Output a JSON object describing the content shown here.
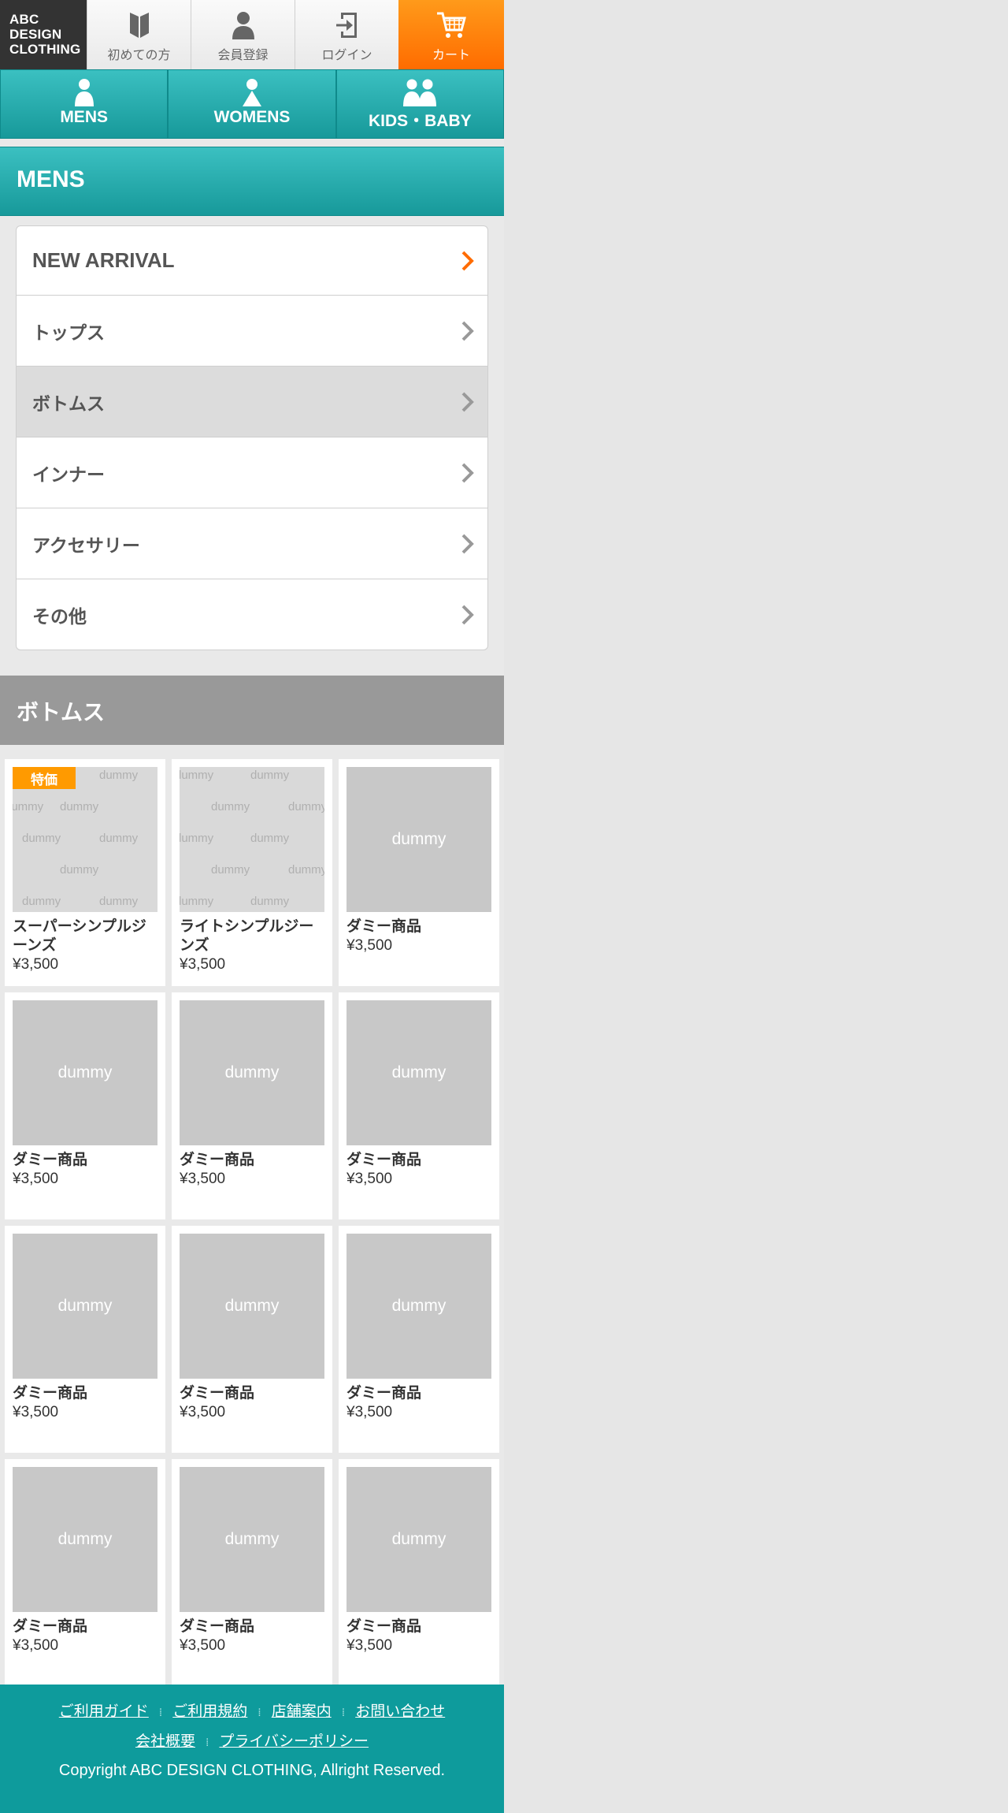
{
  "brand": {
    "logo_lines": [
      "ABC",
      "DESIGN",
      "CLOTHING"
    ]
  },
  "header": {
    "buttons": [
      {
        "label": "初めての方",
        "icon": "book-icon"
      },
      {
        "label": "会員登録",
        "icon": "person-icon"
      },
      {
        "label": "ログイン",
        "icon": "login-icon"
      },
      {
        "label": "カート",
        "icon": "cart-icon"
      }
    ]
  },
  "tabs": [
    {
      "label": "MENS",
      "icon": "man-icon"
    },
    {
      "label": "WOMENS",
      "icon": "woman-icon"
    },
    {
      "label": "KIDS・BABY",
      "icon": "family-icon"
    }
  ],
  "section": {
    "title": "MENS"
  },
  "menu": [
    {
      "label": "NEW ARRIVAL"
    },
    {
      "label": "トップス"
    },
    {
      "label": "ボトムス"
    },
    {
      "label": "インナー"
    },
    {
      "label": "アクセサリー"
    },
    {
      "label": "その他"
    }
  ],
  "products_section": {
    "title": "ボトムス"
  },
  "products": [
    {
      "name": "スーパーシンプルジーンズ",
      "price": "¥3,500",
      "badge": "特価",
      "thumb_text": "dummy"
    },
    {
      "name": "ライトシンプルジーンズ",
      "price": "¥3,500",
      "badge": "",
      "thumb_text": "dummy"
    },
    {
      "name": "ダミー商品",
      "price": "¥3,500",
      "badge": "",
      "thumb_text": "dummy"
    },
    {
      "name": "ダミー商品",
      "price": "¥3,500",
      "badge": "",
      "thumb_text": "dummy"
    },
    {
      "name": "ダミー商品",
      "price": "¥3,500",
      "badge": "",
      "thumb_text": "dummy"
    },
    {
      "name": "ダミー商品",
      "price": "¥3,500",
      "badge": "",
      "thumb_text": "dummy"
    },
    {
      "name": "ダミー商品",
      "price": "¥3,500",
      "badge": "",
      "thumb_text": "dummy"
    },
    {
      "name": "ダミー商品",
      "price": "¥3,500",
      "badge": "",
      "thumb_text": "dummy"
    },
    {
      "name": "ダミー商品",
      "price": "¥3,500",
      "badge": "",
      "thumb_text": "dummy"
    },
    {
      "name": "ダミー商品",
      "price": "¥3,500",
      "badge": "",
      "thumb_text": "dummy"
    },
    {
      "name": "ダミー商品",
      "price": "¥3,500",
      "badge": "",
      "thumb_text": "dummy"
    },
    {
      "name": "ダミー商品",
      "price": "¥3,500",
      "badge": "",
      "thumb_text": "dummy"
    }
  ],
  "footer": {
    "links_row1": [
      "ご利用ガイド",
      "ご利用規約",
      "店舗案内",
      "お問い合わせ"
    ],
    "links_row2": [
      "会社概要",
      "プライバシーポリシー"
    ],
    "copyright": "Copyright ABC DESIGN CLOTHING, Allright Reserved."
  },
  "colors": {
    "teal": "#199ea0",
    "orange": "#ff7a00",
    "gray_header": "#999999"
  }
}
